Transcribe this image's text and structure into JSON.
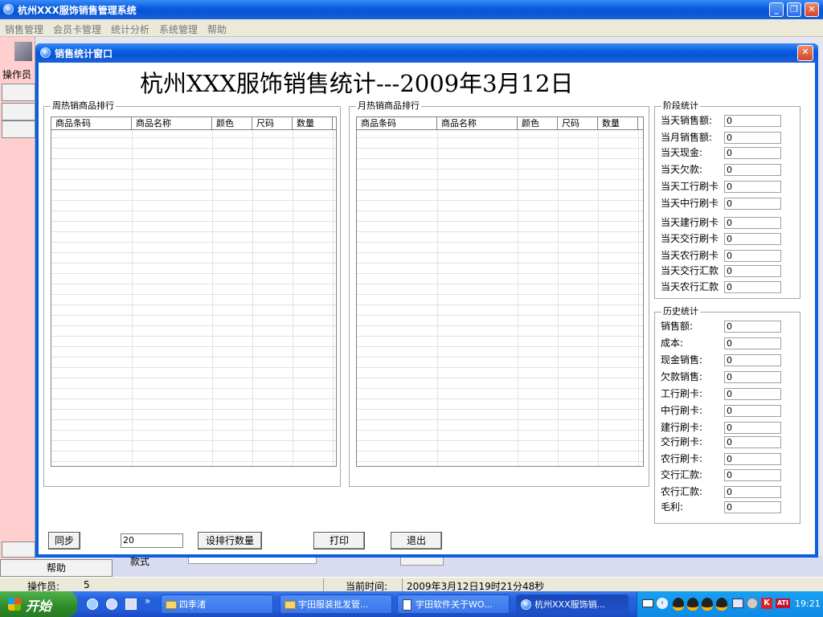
{
  "main_window": {
    "title": "杭州XXX服饰销售管理系统",
    "menu": [
      "销售管理",
      "会员卡管理",
      "统计分析",
      "系统管理",
      "帮助"
    ],
    "sidebar_operator_label": "操作员",
    "sidebar_help_label": "帮助",
    "bg_partial_label": "款式",
    "status": {
      "operator_label": "操作员:",
      "operator_value": "5",
      "time_label": "当前时间:",
      "time_value": "2009年3月12日19时21分48秒"
    }
  },
  "dialog": {
    "title": "销售统计窗口",
    "heading": "杭州XXX服饰销售统计---2009年3月12日",
    "weekly": {
      "legend": "周热销商品排行",
      "columns": [
        "商品条码",
        "商品名称",
        "颜色",
        "尺码",
        "数量"
      ]
    },
    "monthly": {
      "legend": "月热销商品排行",
      "columns": [
        "商品条码",
        "商品名称",
        "颜色",
        "尺码",
        "数量"
      ]
    },
    "period_stats": {
      "legend": "阶段统计",
      "items": [
        {
          "label": "当天销售额:",
          "value": "0"
        },
        {
          "label": "当月销售额:",
          "value": "0"
        },
        {
          "label": "当天现金:",
          "value": "0"
        },
        {
          "label": "当天欠款:",
          "value": "0"
        },
        {
          "label": "当天工行刷卡",
          "value": "0"
        },
        {
          "label": "当天中行刷卡",
          "value": "0"
        },
        {
          "label": "当天建行刷卡",
          "value": "0"
        },
        {
          "label": "当天交行刷卡",
          "value": "0"
        },
        {
          "label": "当天农行刷卡",
          "value": "0"
        },
        {
          "label": "当天交行汇款",
          "value": "0"
        },
        {
          "label": "当天农行汇款",
          "value": "0"
        }
      ]
    },
    "history_stats": {
      "legend": "历史统计",
      "items": [
        {
          "label": "销售额:",
          "value": "0"
        },
        {
          "label": "成本:",
          "value": "0"
        },
        {
          "label": "现金销售:",
          "value": "0"
        },
        {
          "label": "欠款销售:",
          "value": "0"
        },
        {
          "label": "工行刷卡:",
          "value": "0"
        },
        {
          "label": "中行刷卡:",
          "value": "0"
        },
        {
          "label": "建行刷卡:",
          "value": "0"
        },
        {
          "label": "交行刷卡:",
          "value": "0"
        },
        {
          "label": "农行刷卡:",
          "value": "0"
        },
        {
          "label": "交行汇款:",
          "value": "0"
        },
        {
          "label": "农行汇款:",
          "value": "0"
        },
        {
          "label": "毛利:",
          "value": "0"
        }
      ]
    },
    "buttons": {
      "sync": "同步",
      "rank_count_value": "20",
      "set_rank": "设排行数量",
      "print": "打印",
      "exit": "退出"
    }
  },
  "taskbar": {
    "start": "开始",
    "tasks": [
      "四季渚",
      "宇田服装批发管...",
      "宇田软件关于WO...",
      "杭州XXX服饰销..."
    ],
    "clock": "19:21"
  }
}
